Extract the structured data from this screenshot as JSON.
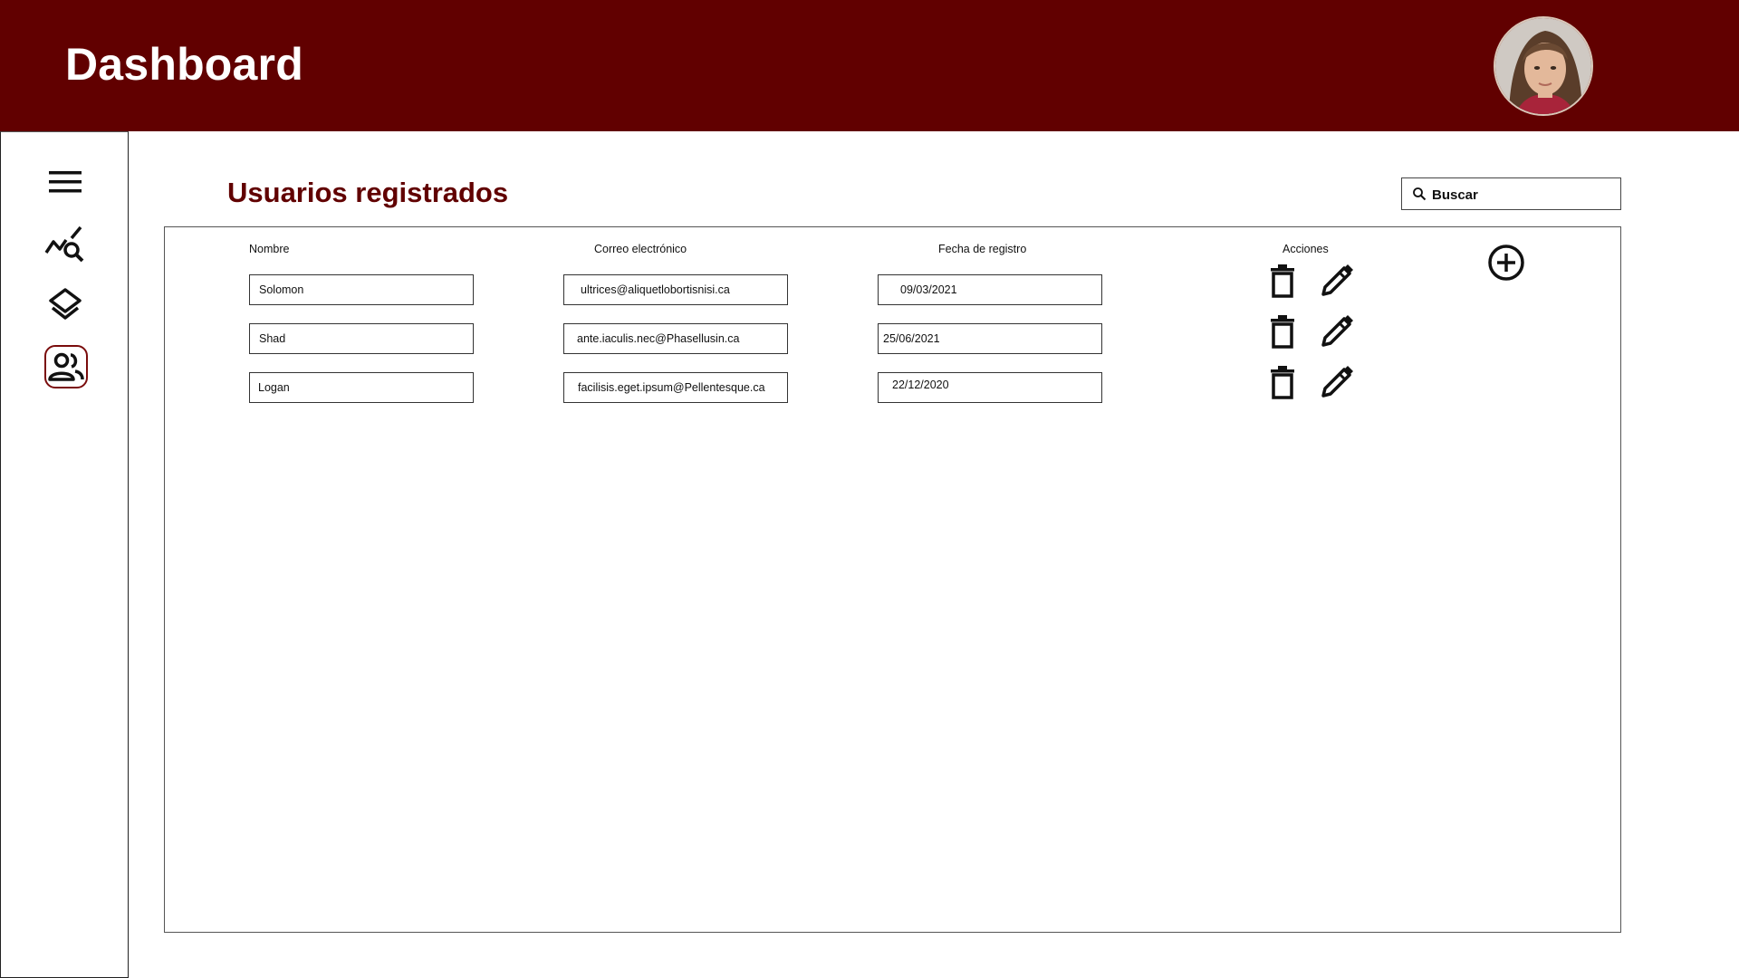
{
  "header": {
    "title": "Dashboard"
  },
  "sidebar": {
    "items": [
      {
        "icon": "menu-icon"
      },
      {
        "icon": "analytics-search-icon"
      },
      {
        "icon": "layers-icon"
      },
      {
        "icon": "users-icon",
        "active": true
      }
    ]
  },
  "main": {
    "section_title": "Usuarios registrados",
    "search": {
      "placeholder": "Buscar"
    },
    "table": {
      "columns": [
        "Nombre",
        "Correo electrónico",
        "Fecha de registro",
        "Acciones"
      ],
      "rows": [
        {
          "name": "Solomon",
          "email": "ultrices@aliquetlobortisnisi.ca",
          "date": "09/03/2021"
        },
        {
          "name": "Shad",
          "email": "ante.iaculis.nec@Phasellusin.ca",
          "date": "25/06/2021"
        },
        {
          "name": "Logan",
          "email": "facilisis.eget.ipsum@Pellentesque.ca",
          "date": "22/12/2020"
        }
      ]
    }
  },
  "colors": {
    "brand": "#610000",
    "background": "#ffffff",
    "text": "#111111"
  }
}
